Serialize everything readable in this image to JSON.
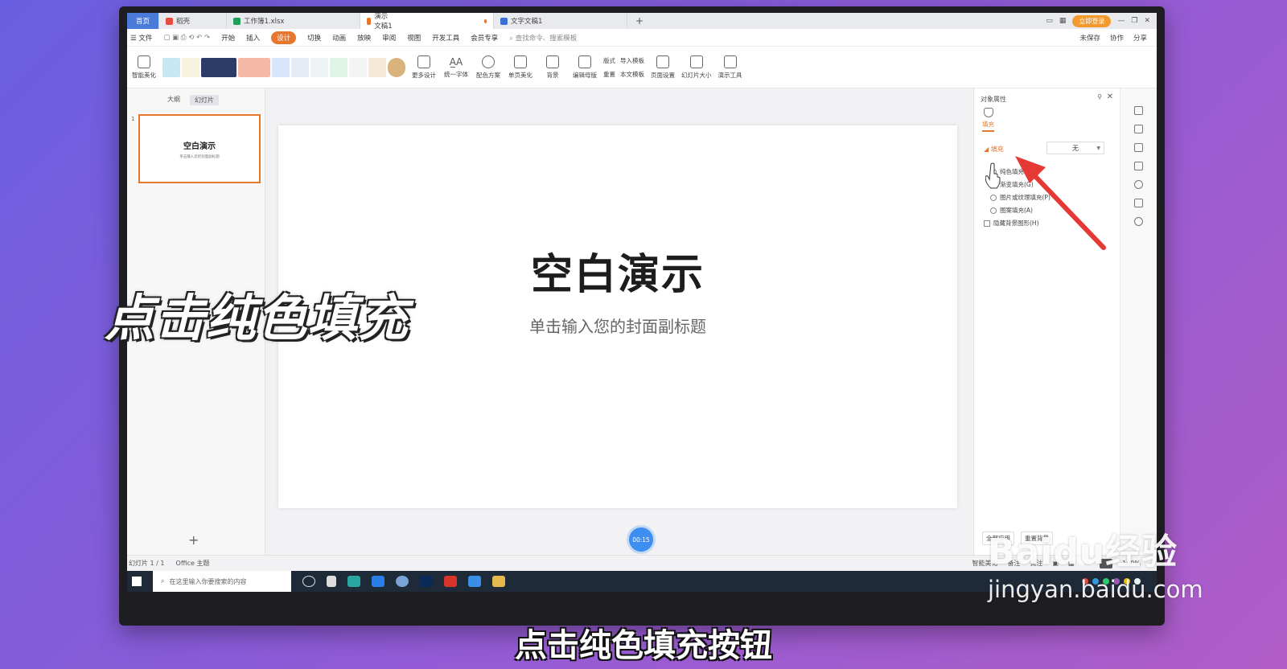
{
  "tabs": [
    {
      "label": "首页"
    },
    {
      "label": "稻壳"
    },
    {
      "label": "工作簿1.xlsx"
    },
    {
      "label": "演示文稿1"
    },
    {
      "label": "文字文稿1"
    }
  ],
  "tab_right": {
    "login": "立即登录"
  },
  "menu": {
    "file": "文件",
    "items": [
      "开始",
      "插入",
      "设计",
      "切换",
      "动画",
      "放映",
      "审阅",
      "视图",
      "开发工具",
      "会员专享"
    ],
    "active": "设计",
    "search": "查找命令、搜索模板",
    "right": [
      "未保存",
      "协作",
      "分享"
    ]
  },
  "toolbar": {
    "smart": "智能美化",
    "more_design": "更多设计",
    "font": "统一字体",
    "color": "配色方案",
    "single": "单页美化",
    "background": "背景",
    "edit_master": "编辑母版",
    "layout": "版式",
    "reset": "重置",
    "import_tpl": "导入模板",
    "doc_tpl": "本文模板",
    "page_setup": "页面设置",
    "slide_size": "幻灯片大小",
    "tools": "演示工具"
  },
  "left_panel": {
    "tab_outline": "大纲",
    "tab_slides": "幻灯片",
    "slide_number": "1",
    "thumb_title": "空白演示",
    "thumb_subtitle": "单击输入您的封面副标题",
    "add": "+"
  },
  "slide": {
    "title": "空白演示",
    "subtitle": "单击输入您的封面副标题"
  },
  "timer": "00:15",
  "right_panel": {
    "title": "对象属性",
    "tab_fill": "填充",
    "section": "填充",
    "select_value": "无",
    "options": [
      "纯色填充(S)",
      "渐变填充(G)",
      "图片或纹理填充(P)",
      "图案填充(A)"
    ],
    "hide_bg": "隐藏背景图形(H)",
    "btn_apply_all": "全部应用",
    "btn_reset_bg": "重置背景"
  },
  "status": {
    "slide": "幻灯片 1 / 1",
    "theme": "Office 主题",
    "smart": "智能美化",
    "notes": "备注",
    "comments": "批注",
    "zoom": "100%"
  },
  "taskbar": {
    "search": "在这里输入你要搜索的内容"
  },
  "overlay": {
    "left_text": "点击纯色填充",
    "caption": "点击纯色填充按钮"
  },
  "watermark": {
    "line1": "Baidu经验",
    "line2": "jingyan.baidu.com"
  },
  "colors": {
    "accent": "#e8772e",
    "arrow": "#e53935",
    "timer": "#3d8ef0"
  }
}
